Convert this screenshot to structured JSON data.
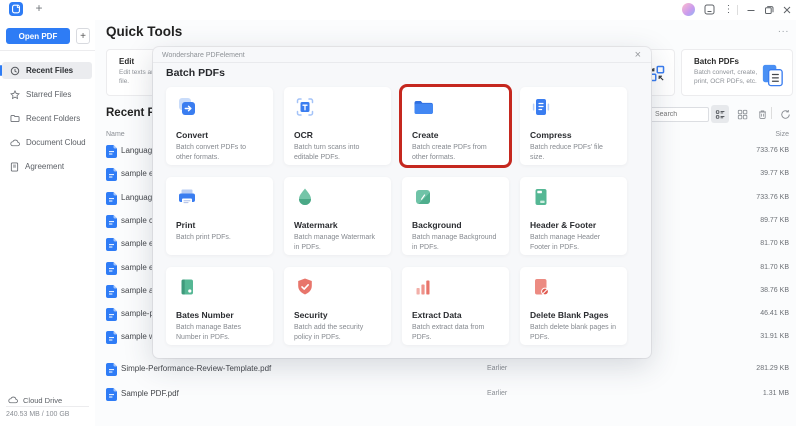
{
  "topbar": {
    "new_tab_glyph": "+",
    "menu_glyph": "⋮"
  },
  "sidebar": {
    "open_button": "Open PDF",
    "add_button": "+",
    "items": [
      {
        "label": "Recent Files",
        "icon": "history-icon",
        "selected": true
      },
      {
        "label": "Starred Files",
        "icon": "star-icon",
        "selected": false
      },
      {
        "label": "Recent Folders",
        "icon": "folder-icon",
        "selected": false
      },
      {
        "label": "Document Cloud",
        "icon": "cloud-icon",
        "selected": false
      },
      {
        "label": "Agreement",
        "icon": "agreement-icon",
        "selected": false
      }
    ],
    "cloud_drive_label": "Cloud Drive",
    "storage": "240.53 MB / 100 GB"
  },
  "main": {
    "title": "Quick Tools",
    "more_glyph": "...",
    "edit_card": {
      "title": "Edit",
      "desc_line1": "Edit texts and",
      "desc_line2": "file."
    },
    "batch_card": {
      "title": "Batch PDFs",
      "desc_line1": "Batch convert, create,",
      "desc_line2": "print, OCR PDFs, etc."
    },
    "recent": {
      "title": "Recent Files",
      "search_placeholder": "Search",
      "columns": {
        "name": "Name",
        "size": "Size"
      },
      "rows": [
        {
          "name": "Language",
          "size": "733.76 KB"
        },
        {
          "name": "sample e",
          "size": "39.77 KB"
        },
        {
          "name": "Language",
          "size": "733.76 KB"
        },
        {
          "name": "sample cl",
          "size": "89.77 KB"
        },
        {
          "name": "sample e",
          "size": "81.70 KB"
        },
        {
          "name": "sample e",
          "size": "81.70 KB"
        },
        {
          "name": "sample a",
          "size": "38.76 KB"
        },
        {
          "name": "sample-p",
          "size": "46.41 KB"
        },
        {
          "name": "sample w",
          "size": "31.91 KB"
        },
        {
          "name": "Simple-Performance-Review-Template.pdf",
          "date": "Earlier",
          "size": "281.29 KB"
        },
        {
          "name": "Sample PDF.pdf",
          "date": "Earlier",
          "size": "1.31 MB"
        }
      ]
    }
  },
  "dialog": {
    "title": "Wondershare PDFelement",
    "close_glyph": "×",
    "heading": "Batch PDFs",
    "tools": [
      {
        "name": "Convert",
        "desc": "Batch convert PDFs to other formats.",
        "icon": "convert-icon",
        "highlighted": false
      },
      {
        "name": "OCR",
        "desc": "Batch turn scans into editable PDFs.",
        "icon": "ocr-icon",
        "highlighted": false
      },
      {
        "name": "Create",
        "desc": "Batch create PDFs from other formats.",
        "icon": "create-icon",
        "highlighted": true
      },
      {
        "name": "Compress",
        "desc": "Batch reduce PDFs' file size.",
        "icon": "compress-icon",
        "highlighted": false
      },
      {
        "name": "Print",
        "desc": "Batch print PDFs.",
        "icon": "print-icon",
        "highlighted": false
      },
      {
        "name": "Watermark",
        "desc": "Batch manage Watermark in PDFs.",
        "icon": "watermark-icon",
        "highlighted": false
      },
      {
        "name": "Background",
        "desc": "Batch manage Background in PDFs.",
        "icon": "background-icon",
        "highlighted": false
      },
      {
        "name": "Header & Footer",
        "desc": "Batch manage Header Footer in PDFs.",
        "icon": "header-footer-icon",
        "highlighted": false
      },
      {
        "name": "Bates Number",
        "desc": "Batch manage Bates Number in PDFs.",
        "icon": "bates-number-icon",
        "highlighted": false
      },
      {
        "name": "Security",
        "desc": "Batch add the security policy in PDFs.",
        "icon": "security-icon",
        "highlighted": false
      },
      {
        "name": "Extract Data",
        "desc": "Batch extract data from PDFs.",
        "icon": "extract-data-icon",
        "highlighted": false
      },
      {
        "name": "Delete Blank Pages",
        "desc": "Batch delete blank pages in PDFs.",
        "icon": "delete-blank-pages-icon",
        "highlighted": false
      }
    ]
  },
  "colors": {
    "accent_blue": "#2e7cf5",
    "highlight_red": "#c5281f",
    "tool_blue": "#3a7df0",
    "tool_green": "#55b794",
    "tool_red": "#e8756b"
  }
}
